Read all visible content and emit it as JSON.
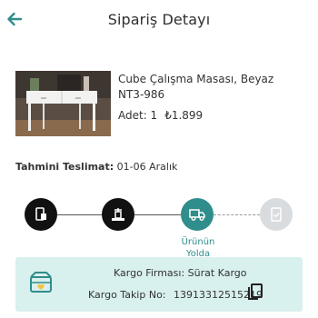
{
  "header": {
    "title": "Sipariş Detayı",
    "back_icon": "arrow-left-icon"
  },
  "product": {
    "name": "Cube Çalışma Masası, Beyaz",
    "code": "NT3-986",
    "quantity_label": "Adet: 1",
    "price": "₺1.899"
  },
  "delivery": {
    "label": "Tahmini Teslimat:",
    "value": " 01-06 Aralık"
  },
  "tracking": {
    "active_label_line1": "Ürünün",
    "active_label_line2": "Yolda",
    "steps": [
      {
        "icon": "order-received-icon",
        "state": "done"
      },
      {
        "icon": "package-prepared-icon",
        "state": "done"
      },
      {
        "icon": "truck-icon",
        "state": "active"
      },
      {
        "icon": "delivered-icon",
        "state": "pending"
      }
    ]
  },
  "cargo": {
    "firm": "Kargo Firması: Sürat Kargo",
    "tracking_label": "Kargo Takip No:",
    "tracking_number": "13913312515219",
    "copy_icon": "copy-icon"
  },
  "colors": {
    "accent": "#2f8d8b",
    "cargo_bg": "#d8f0ee",
    "done": "#111111",
    "pending": "#d9dcdf"
  }
}
